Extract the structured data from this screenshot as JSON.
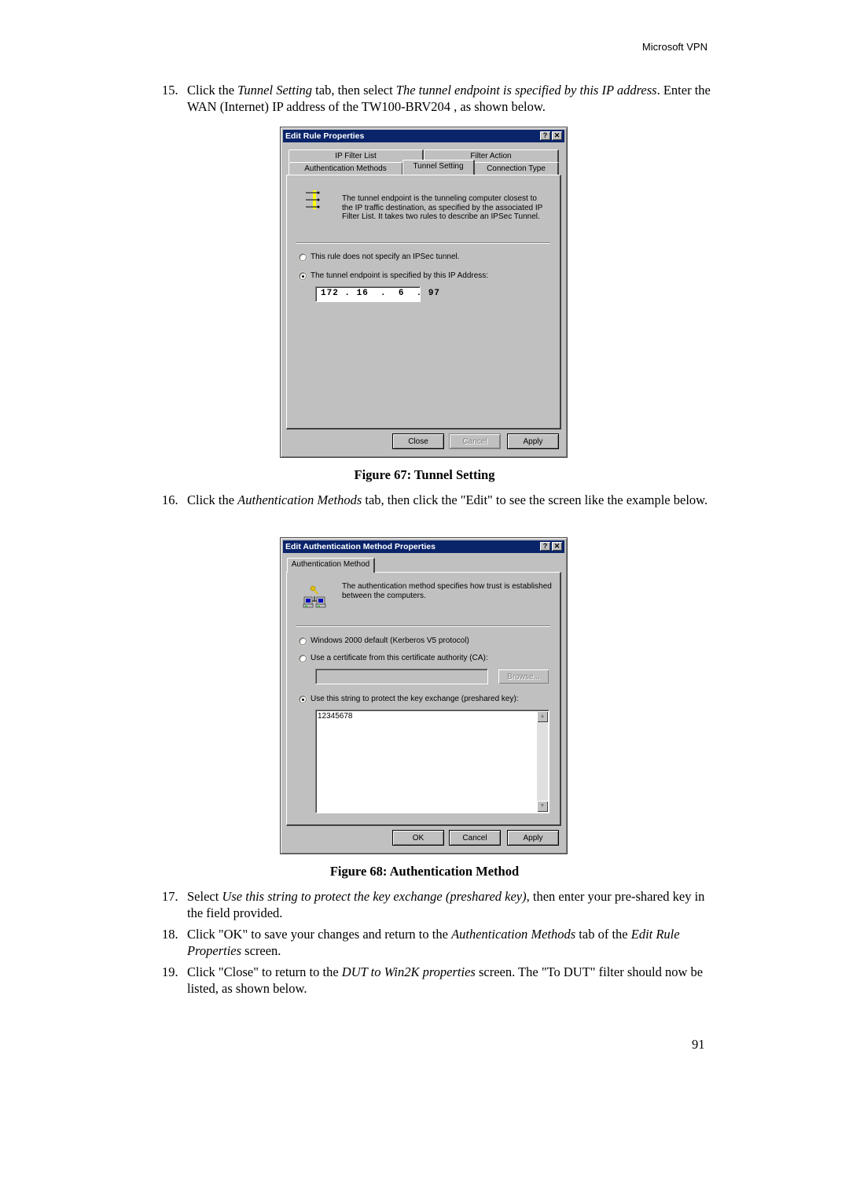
{
  "header": "Microsoft VPN",
  "steps": [
    {
      "num": "15.",
      "parts": [
        "Click the ",
        "Tunnel Setting",
        " tab, then select ",
        "The tunnel endpoint is specified by this IP address",
        ". Enter the WAN (Internet) IP address of the TW100-BRV204 , as shown below."
      ]
    },
    {
      "num": "16.",
      "parts": [
        "Click the ",
        "Authentication Methods",
        " tab, then click the \"Edit\" to see the screen like the example below."
      ]
    },
    {
      "num": "17.",
      "parts": [
        "Select ",
        "Use this string to protect the key exchange (preshared key)",
        ", then enter your pre-shared key in the field provided."
      ]
    },
    {
      "num": "18.",
      "parts": [
        "Click \"OK\" to save your changes and return to the ",
        "Authentication Methods",
        " tab of the ",
        "Edit Rule Properties",
        " screen."
      ]
    },
    {
      "num": "19.",
      "parts": [
        "Click \"Close\" to return to the ",
        "DUT to Win2K properties",
        " screen. The \"To DUT\" filter should now be listed, as shown below."
      ]
    }
  ],
  "figure67": {
    "caption": "Figure 67: Tunnel Setting",
    "title": "Edit Rule Properties",
    "help_btn": "?",
    "close_btn": "✕",
    "tabs_row1": [
      "IP Filter List",
      "Filter Action"
    ],
    "tabs_row2": [
      "Authentication Methods",
      "Tunnel Setting",
      "Connection Type"
    ],
    "active_tab": "Tunnel Setting",
    "description": "The tunnel endpoint is the tunneling computer closest to the IP traffic destination, as specified by the associated IP Filter List. It takes two rules to describe an IPSec Tunnel.",
    "radio1": "This rule does not specify an IPSec tunnel.",
    "radio2": "The tunnel endpoint is specified by this IP Address:",
    "radio_selected": 2,
    "ip_octets": [
      "172",
      "16",
      "6",
      "97"
    ],
    "ip_display": "172 . 16  .  6  . 97",
    "buttons": {
      "close": "Close",
      "cancel": "Cancel",
      "apply": "Apply"
    }
  },
  "figure68": {
    "caption": "Figure 68: Authentication Method",
    "title": "Edit Authentication Method Properties",
    "help_btn": "?",
    "close_btn": "✕",
    "tab": "Authentication Method",
    "description": "The authentication method specifies how trust is established between the computers.",
    "radio1": "Windows 2000 default (Kerberos V5 protocol)",
    "radio2": "Use a certificate from this certificate authority (CA):",
    "browse": "Browse...",
    "radio3": "Use this string to protect the key exchange (preshared key):",
    "radio_selected": 3,
    "preshared_key": "12345678",
    "buttons": {
      "ok": "OK",
      "cancel": "Cancel",
      "apply": "Apply"
    }
  },
  "page_number": "91"
}
